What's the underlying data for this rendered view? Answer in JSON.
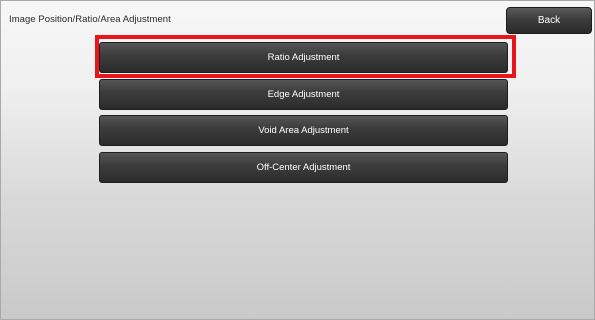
{
  "screen": {
    "title": "Image Position/Ratio/Area Adjustment",
    "back_label": "Back"
  },
  "menu": {
    "items": [
      {
        "label": "Ratio Adjustment"
      },
      {
        "label": "Edge Adjustment"
      },
      {
        "label": "Void Area Adjustment"
      },
      {
        "label": "Off-Center Adjustment"
      }
    ],
    "highlighted_index": 0
  },
  "colors": {
    "highlight": "#e8151b",
    "button_bg": "#3d3d3d",
    "button_text": "#ffffff"
  }
}
